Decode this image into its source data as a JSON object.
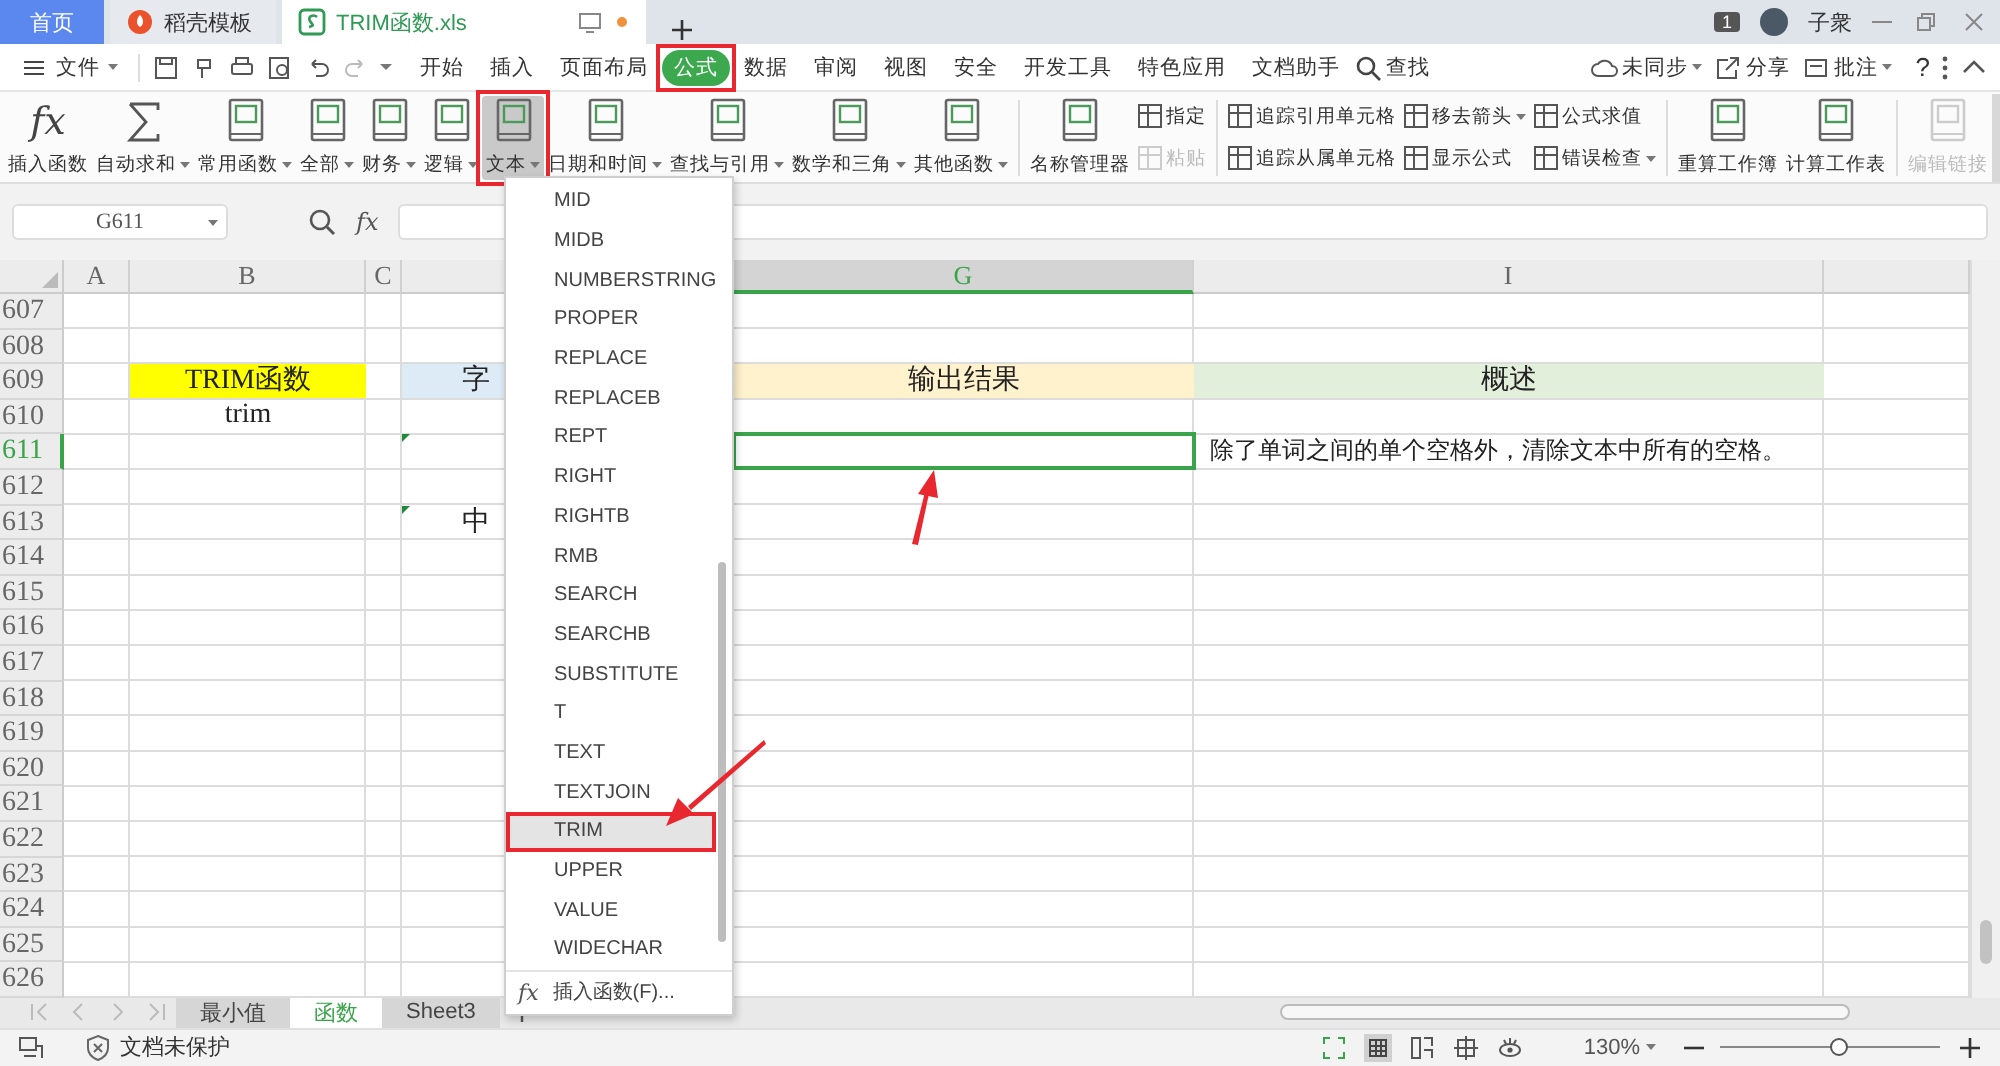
{
  "title_tabs": [
    {
      "label": "首页",
      "kind": "home",
      "selected": false
    },
    {
      "label": "稻壳模板",
      "kind": "docer",
      "selected": false
    },
    {
      "label": "TRIM函数.xls",
      "kind": "sheet",
      "selected": true
    }
  ],
  "account": {
    "badge": "1",
    "user": "子衆"
  },
  "menu": {
    "file": "文件",
    "tabs": [
      {
        "label": "开始",
        "selected": false
      },
      {
        "label": "插入",
        "selected": false
      },
      {
        "label": "页面布局",
        "selected": false
      },
      {
        "label": "公式",
        "selected": true
      },
      {
        "label": "数据",
        "selected": false
      },
      {
        "label": "审阅",
        "selected": false
      },
      {
        "label": "视图",
        "selected": false
      },
      {
        "label": "安全",
        "selected": false
      },
      {
        "label": "开发工具",
        "selected": false
      },
      {
        "label": "特色应用",
        "selected": false
      },
      {
        "label": "文档助手",
        "selected": false
      }
    ],
    "search": "查找",
    "sync": "未同步",
    "share": "分享",
    "comment": "批注",
    "help": "?"
  },
  "ribbon": [
    {
      "kind": "big",
      "label": "插入函数",
      "glyph": "fx",
      "dropdown": false,
      "pressed": false,
      "disabled": false
    },
    {
      "kind": "big",
      "label": "自动求和",
      "dropdown": true,
      "pressed": false,
      "disabled": false
    },
    {
      "kind": "big",
      "label": "常用函数",
      "dropdown": true,
      "pressed": false,
      "disabled": false
    },
    {
      "kind": "big",
      "label": "全部",
      "dropdown": true,
      "pressed": false,
      "disabled": false
    },
    {
      "kind": "big",
      "label": "财务",
      "dropdown": true,
      "pressed": false,
      "disabled": false
    },
    {
      "kind": "big",
      "label": "逻辑",
      "dropdown": true,
      "pressed": false,
      "disabled": false
    },
    {
      "kind": "big",
      "label": "文本",
      "dropdown": true,
      "pressed": true,
      "disabled": false
    },
    {
      "kind": "big",
      "label": "日期和时间",
      "dropdown": true,
      "pressed": false,
      "disabled": false
    },
    {
      "kind": "big",
      "label": "查找与引用",
      "dropdown": true,
      "pressed": false,
      "disabled": false
    },
    {
      "kind": "big",
      "label": "数学和三角",
      "dropdown": true,
      "pressed": false,
      "disabled": false
    },
    {
      "kind": "big",
      "label": "其他函数",
      "dropdown": true,
      "pressed": false,
      "disabled": false
    },
    {
      "kind": "separator"
    },
    {
      "kind": "big",
      "label": "名称管理器",
      "dropdown": false,
      "pressed": false,
      "disabled": false
    },
    {
      "kind": "stack",
      "items": [
        {
          "label": "指定",
          "dropdown": false,
          "disabled": false
        },
        {
          "label": "粘贴",
          "dropdown": false,
          "disabled": true
        }
      ]
    },
    {
      "kind": "separator"
    },
    {
      "kind": "stack",
      "items": [
        {
          "label": "追踪引用单元格",
          "dropdown": false,
          "disabled": false
        },
        {
          "label": "追踪从属单元格",
          "dropdown": false,
          "disabled": false
        }
      ]
    },
    {
      "kind": "stack",
      "items": [
        {
          "label": "移去箭头",
          "dropdown": true,
          "disabled": false
        },
        {
          "label": "显示公式",
          "dropdown": false,
          "disabled": false
        }
      ]
    },
    {
      "kind": "stack",
      "items": [
        {
          "label": "公式求值",
          "dropdown": false,
          "disabled": false
        },
        {
          "label": "错误检查",
          "dropdown": true,
          "disabled": false
        }
      ]
    },
    {
      "kind": "separator"
    },
    {
      "kind": "big",
      "label": "重算工作簿",
      "dropdown": false,
      "pressed": false,
      "disabled": false
    },
    {
      "kind": "big",
      "label": "计算工作表",
      "dropdown": false,
      "pressed": false,
      "disabled": false
    },
    {
      "kind": "separator"
    },
    {
      "kind": "big",
      "label": "编辑链接",
      "dropdown": false,
      "pressed": false,
      "disabled": true
    }
  ],
  "formula_bar": {
    "name_box": "G611",
    "fx": "fx"
  },
  "columns": [
    {
      "label": "A",
      "selected": false
    },
    {
      "label": "B",
      "selected": false
    },
    {
      "label": "C",
      "selected": false
    },
    {
      "selected": false
    },
    {
      "label": "G",
      "selected": true
    },
    {
      "label": "I",
      "selected": false
    },
    {
      "selected": false
    }
  ],
  "rows": [
    {
      "number": "607",
      "selected": false,
      "cells": {}
    },
    {
      "number": "608",
      "selected": false,
      "cells": {}
    },
    {
      "number": "609",
      "selected": false,
      "cells": {
        "B": {
          "text": "TRIM函数",
          "color": "#ffff00"
        },
        "column_4": {
          "text": "字",
          "color": "#ddebf7"
        },
        "G": {
          "text": "输出结果",
          "color": "#fff2cc"
        },
        "I": {
          "text": "概述",
          "color": "#e2efda"
        }
      }
    },
    {
      "number": "610",
      "selected": false,
      "cells": {
        "B": {
          "text": "trim"
        }
      }
    },
    {
      "number": "611",
      "selected": true,
      "cells": {
        "column_4": {
          "flag": true
        },
        "G": {
          "selected": true
        },
        "I": {
          "text": "除了单词之间的单个空格外，清除文本中所有的空格。"
        }
      }
    },
    {
      "number": "612",
      "selected": false,
      "cells": {}
    },
    {
      "number": "613",
      "selected": false,
      "cells": {
        "column_4": {
          "flag": true,
          "text": "中"
        }
      }
    },
    {
      "number": "614",
      "selected": false,
      "cells": {}
    },
    {
      "number": "615",
      "selected": false,
      "cells": {}
    },
    {
      "number": "616",
      "selected": false,
      "cells": {}
    },
    {
      "number": "617",
      "selected": false,
      "cells": {}
    },
    {
      "number": "618",
      "selected": false,
      "cells": {}
    },
    {
      "number": "619",
      "selected": false,
      "cells": {}
    },
    {
      "number": "620",
      "selected": false,
      "cells": {}
    },
    {
      "number": "621",
      "selected": false,
      "cells": {}
    },
    {
      "number": "622",
      "selected": false,
      "cells": {}
    },
    {
      "number": "623",
      "selected": false,
      "cells": {}
    },
    {
      "number": "624",
      "selected": false,
      "cells": {}
    },
    {
      "number": "625",
      "selected": false,
      "cells": {}
    },
    {
      "number": "626",
      "selected": false,
      "cells": {}
    }
  ],
  "function_menu": {
    "items": [
      {
        "label": "MID",
        "selected": false
      },
      {
        "label": "MIDB",
        "selected": false
      },
      {
        "label": "NUMBERSTRING",
        "selected": false
      },
      {
        "label": "PROPER",
        "selected": false
      },
      {
        "label": "REPLACE",
        "selected": false
      },
      {
        "label": "REPLACEB",
        "selected": false
      },
      {
        "label": "REPT",
        "selected": false
      },
      {
        "label": "RIGHT",
        "selected": false
      },
      {
        "label": "RIGHTB",
        "selected": false
      },
      {
        "label": "RMB",
        "selected": false
      },
      {
        "label": "SEARCH",
        "selected": false
      },
      {
        "label": "SEARCHB",
        "selected": false
      },
      {
        "label": "SUBSTITUTE",
        "selected": false
      },
      {
        "label": "T",
        "selected": false
      },
      {
        "label": "TEXT",
        "selected": false
      },
      {
        "label": "TEXTJOIN",
        "selected": false
      },
      {
        "label": "TRIM",
        "selected": true
      },
      {
        "label": "UPPER",
        "selected": false
      },
      {
        "label": "VALUE",
        "selected": false
      },
      {
        "label": "WIDECHAR",
        "selected": false
      }
    ],
    "footer_glyph": "fx",
    "footer": "插入函数(F)..."
  },
  "sheet_tabs": [
    {
      "label": "最小值",
      "selected": false
    },
    {
      "label": "函数",
      "selected": true
    },
    {
      "label": "Sheet3",
      "selected": false
    }
  ],
  "status_bar": {
    "protection": "文档未保护",
    "zoom": "130%",
    "zoom_slider": {
      "level": 0.54
    }
  }
}
